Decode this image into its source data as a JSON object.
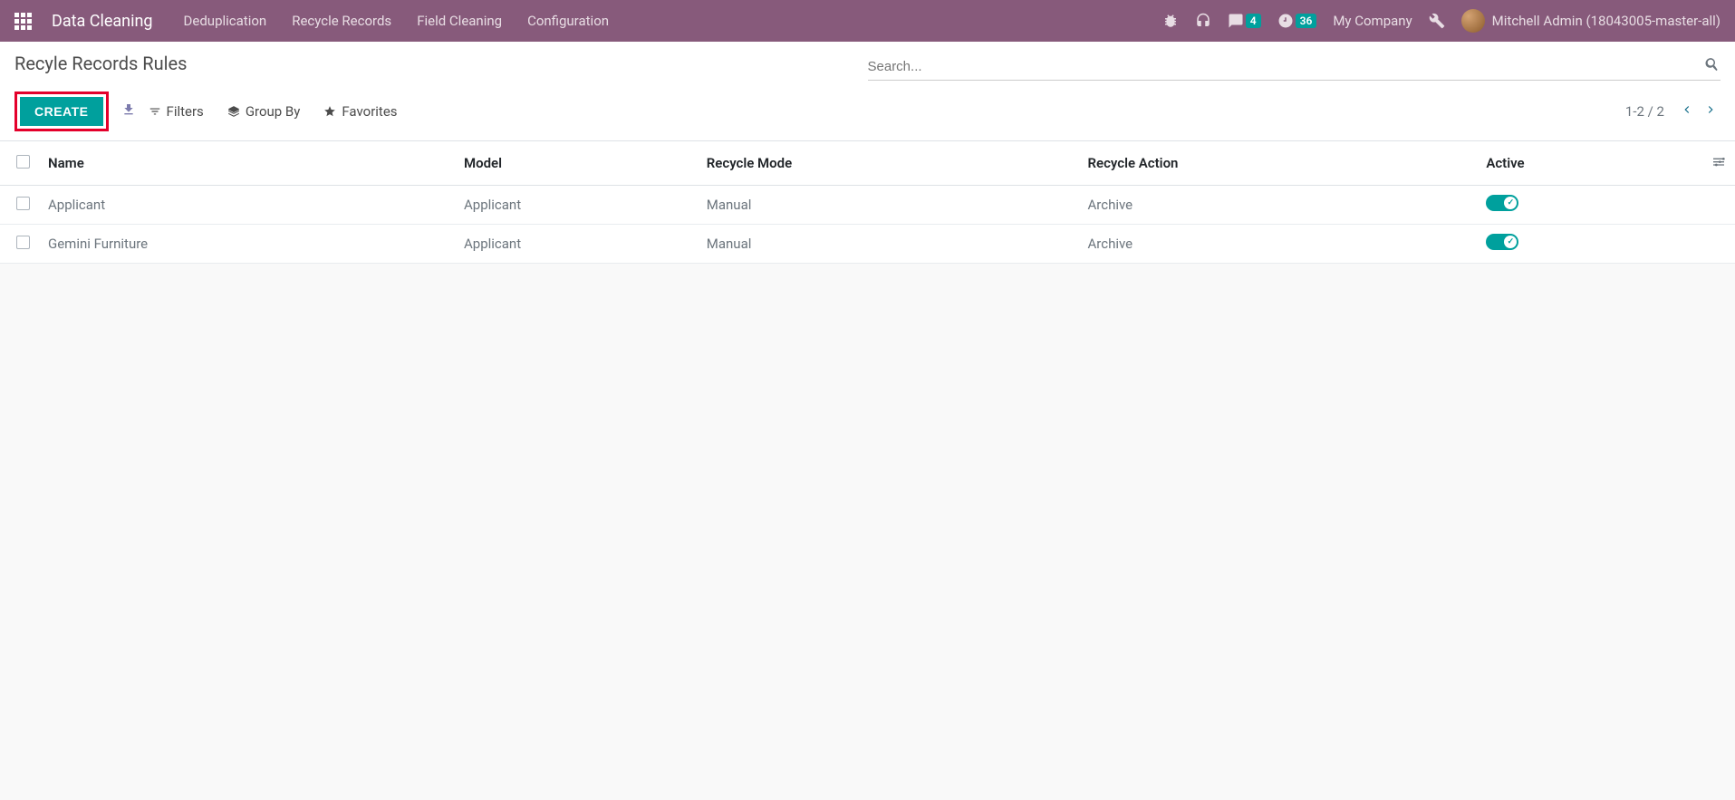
{
  "navbar": {
    "brand": "Data Cleaning",
    "links": [
      "Deduplication",
      "Recycle Records",
      "Field Cleaning",
      "Configuration"
    ],
    "messages_badge": "4",
    "activities_badge": "36",
    "company": "My Company",
    "user": "Mitchell Admin (18043005-master-all)"
  },
  "control": {
    "title": "Recyle Records Rules",
    "search_placeholder": "Search...",
    "create": "CREATE",
    "filters": "Filters",
    "groupby": "Group By",
    "favorites": "Favorites",
    "pager": "1-2 / 2"
  },
  "table": {
    "headers": {
      "name": "Name",
      "model": "Model",
      "mode": "Recycle Mode",
      "action": "Recycle Action",
      "active": "Active"
    },
    "rows": [
      {
        "name": "Applicant",
        "model": "Applicant",
        "mode": "Manual",
        "action": "Archive",
        "active": true
      },
      {
        "name": "Gemini Furniture",
        "model": "Applicant",
        "mode": "Manual",
        "action": "Archive",
        "active": true
      }
    ]
  }
}
